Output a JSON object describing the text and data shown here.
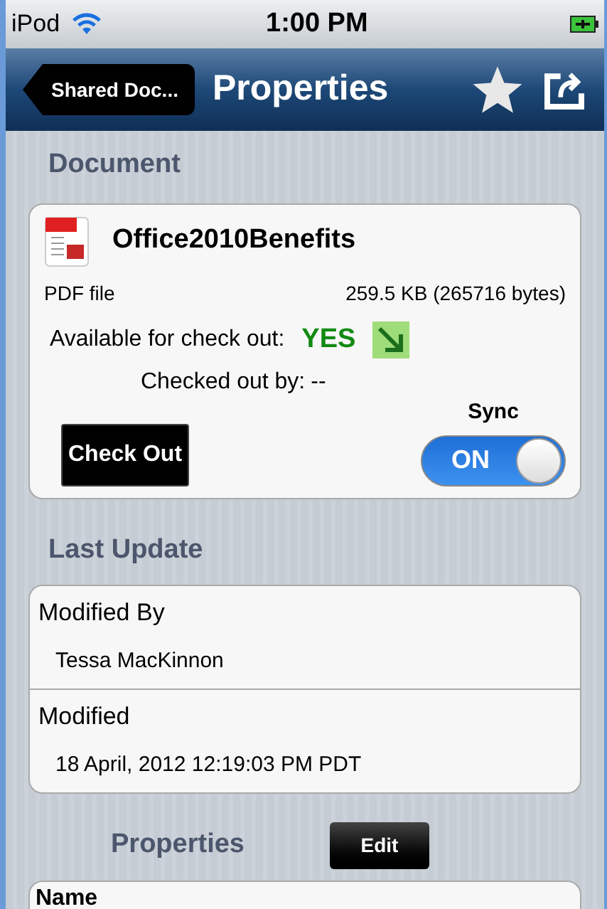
{
  "status_bar": {
    "carrier": "iPod",
    "time": "1:00 PM"
  },
  "nav_bar": {
    "back": "Shared Doc...",
    "title": "Properties"
  },
  "document": {
    "header": "Document",
    "file_name": "Office2010Benefits",
    "file_type": "PDF file",
    "file_size": "259.5 KB (265716 bytes)",
    "available_label": "Available for check out:",
    "available_value": "YES",
    "checked_out_label": "Checked out by:",
    "checked_out_value": "--",
    "check_out_button": "Check Out",
    "sync_label": "Sync",
    "sync": {
      "on": true,
      "label": "ON"
    }
  },
  "last_update": {
    "header": "Last Update",
    "rows": [
      {
        "label": "Modified By",
        "value": "Tessa MacKinnon"
      },
      {
        "label": "Modified",
        "value": "18 April, 2012 12:19:03 PM PDT"
      }
    ]
  },
  "properties": {
    "header": "Properties",
    "edit_button": "Edit",
    "rows": [
      {
        "label": "Name"
      }
    ]
  }
}
